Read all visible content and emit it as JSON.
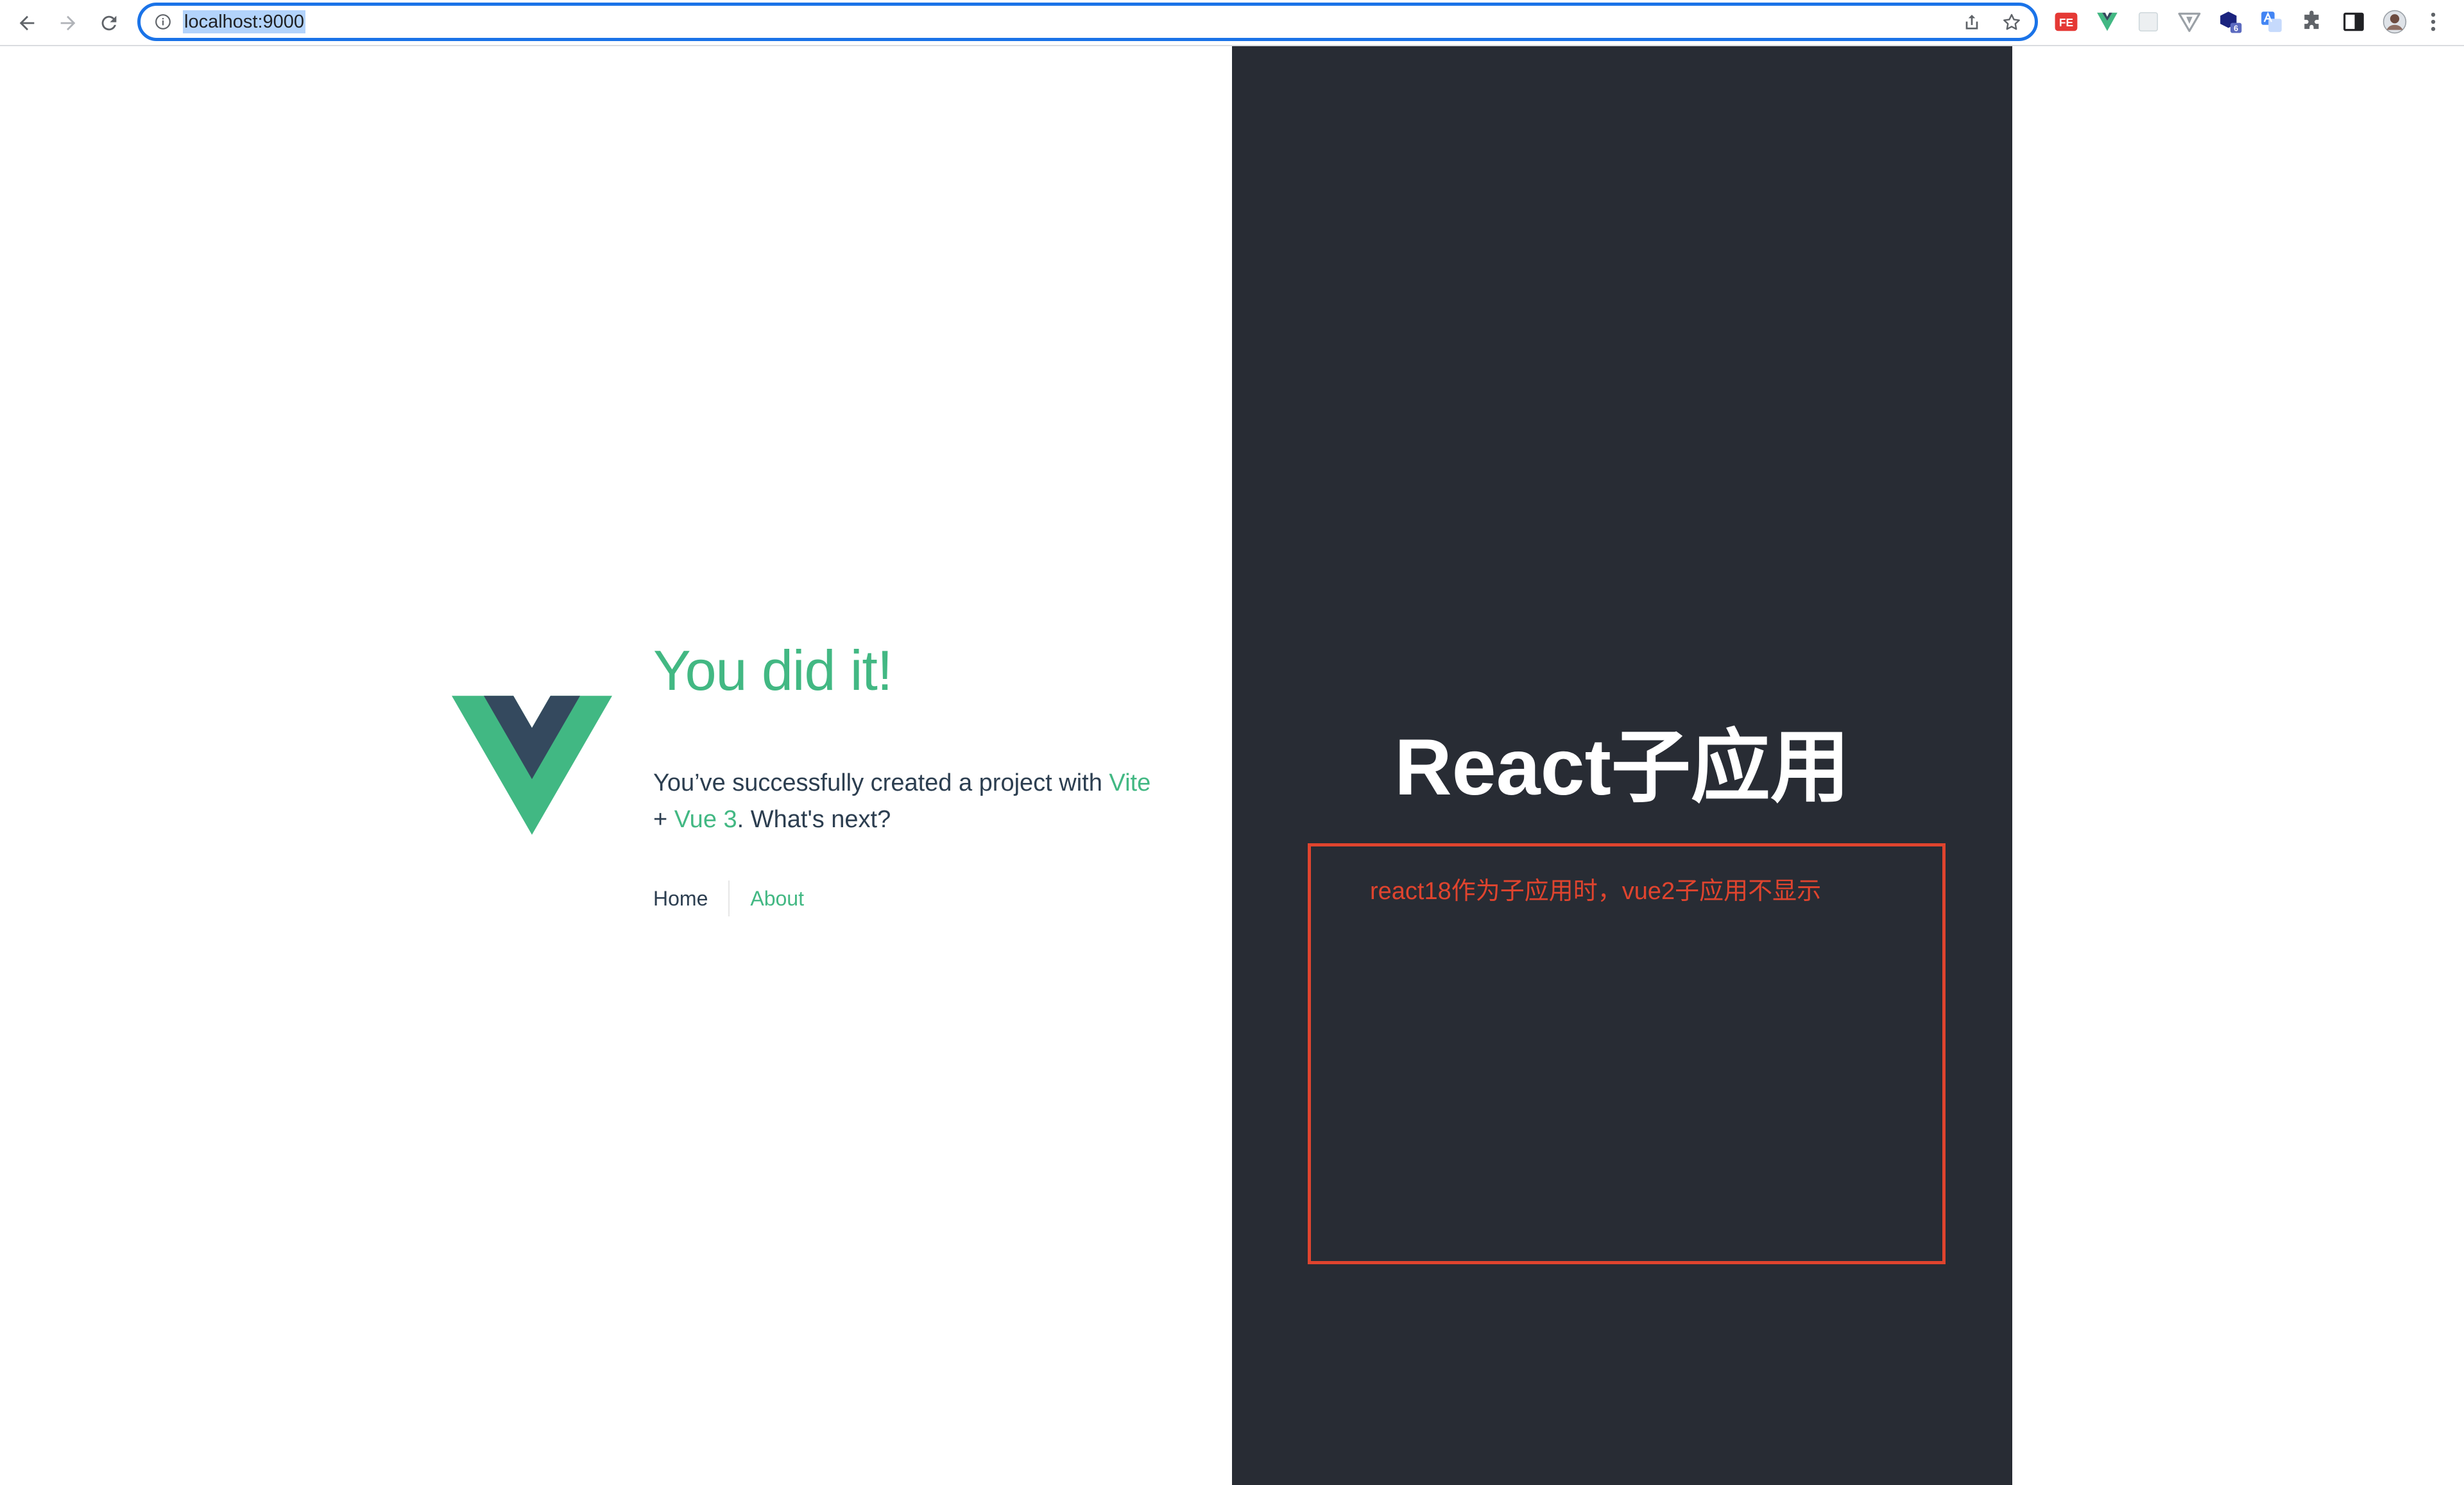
{
  "browser": {
    "url": "localhost:9000",
    "nav": {
      "back_icon": "arrow-left-icon",
      "forward_icon": "arrow-right-icon",
      "reload_icon": "reload-icon"
    },
    "omnibox_icons": [
      "info-icon",
      "share-icon",
      "bookmark-star-icon"
    ],
    "extensions": [
      {
        "name": "fe-extension-icon",
        "label": "FE"
      },
      {
        "name": "vue-devtools-icon"
      },
      {
        "name": "blank-extension-icon"
      },
      {
        "name": "vite-extension-icon"
      },
      {
        "name": "hexagon-extension-icon",
        "badge": "6"
      },
      {
        "name": "translate-extension-icon"
      },
      {
        "name": "puzzle-extensions-icon"
      },
      {
        "name": "side-panel-icon"
      },
      {
        "name": "profile-avatar-icon"
      },
      {
        "name": "kebab-menu-icon"
      }
    ],
    "colors": {
      "focus_ring": "#1a73e8",
      "selection": "#b3d3fb"
    }
  },
  "vue_app": {
    "logo_icon": "vue-logo-icon",
    "title": "You did it!",
    "text_before": "You’ve successfully created a project with ",
    "link_vite": "Vite",
    "text_plus": " + ",
    "link_vue": "Vue 3",
    "text_after": ". What's next?",
    "nav": {
      "home": "Home",
      "about": "About"
    },
    "colors": {
      "brand_green": "#42b883",
      "dark_text": "#2c3e50"
    }
  },
  "react_app": {
    "title": "React子应用",
    "annotation": "react18作为子应用时，vue2子应用不显示",
    "colors": {
      "background": "#282c34",
      "annotation_red": "#e0442e"
    }
  }
}
